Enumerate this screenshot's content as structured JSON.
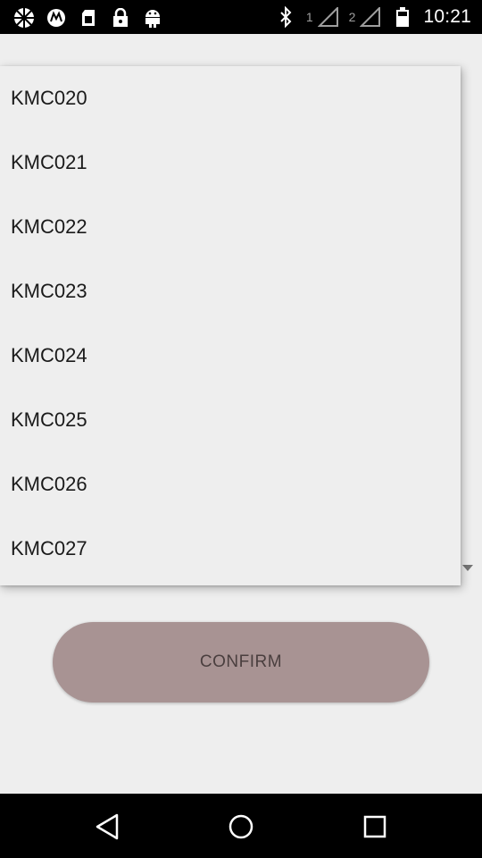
{
  "status_bar": {
    "time": "10:21",
    "sim1_label": "1",
    "sim2_label": "2",
    "left_icons": [
      "aperture-icon",
      "motorola-icon",
      "sim-card-icon",
      "lock-icon",
      "android-icon"
    ],
    "right_icons": [
      "bluetooth-icon",
      "signal-icon",
      "signal-icon",
      "battery-icon"
    ]
  },
  "dropdown": {
    "items": [
      {
        "label": "KMC020"
      },
      {
        "label": "KMC021"
      },
      {
        "label": "KMC022"
      },
      {
        "label": "KMC023"
      },
      {
        "label": "KMC024"
      },
      {
        "label": "KMC025"
      },
      {
        "label": "KMC026"
      },
      {
        "label": "KMC027"
      }
    ]
  },
  "confirm": {
    "label": "CONFIRM",
    "color": "#a89393"
  },
  "nav_bar": {
    "icons": [
      "back-icon",
      "home-icon",
      "recents-icon"
    ]
  }
}
